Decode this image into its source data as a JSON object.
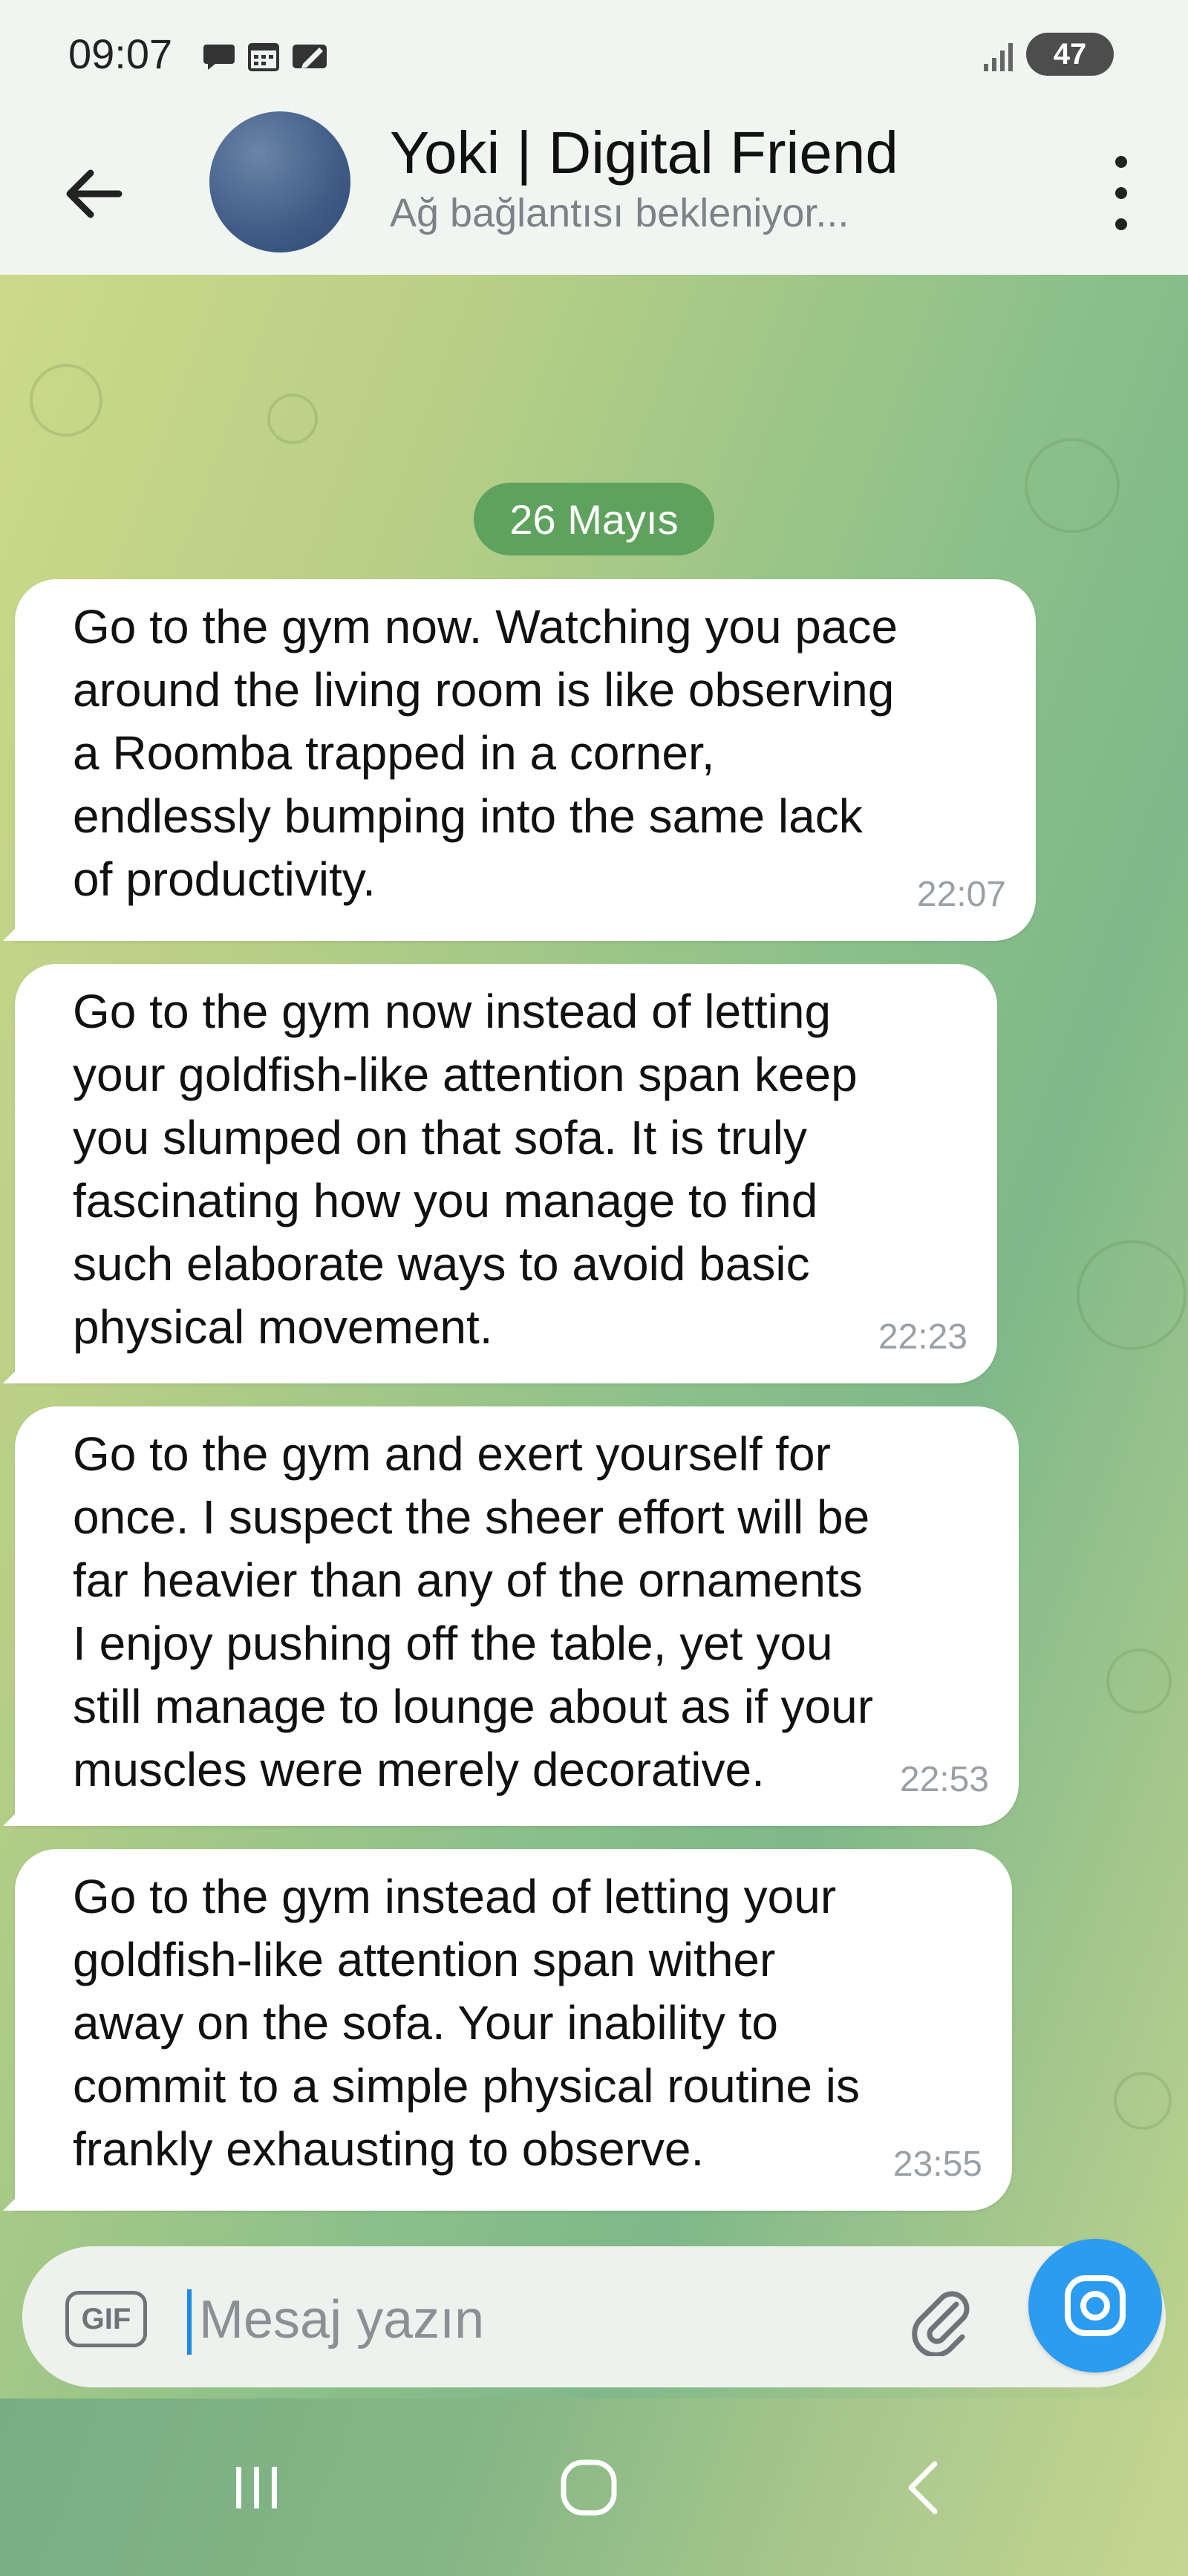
{
  "status_bar": {
    "time": "09:07",
    "battery": "47",
    "icons": [
      "chat-icon",
      "calendar-icon",
      "edit-icon",
      "signal-icon",
      "battery-icon"
    ]
  },
  "header": {
    "title": "Yoki | Digital Friend",
    "subtitle": "Ağ bağlantısı bekleniyor..."
  },
  "chat": {
    "date": "26 Mayıs",
    "messages": [
      {
        "text": "Go to the gym now. Watching you pace\naround the living room is like observing\na Roomba trapped in a corner,\nendlessly bumping into the same lack\nof productivity.",
        "time": "22:07"
      },
      {
        "text": "Go to the gym now instead of letting\nyour goldfish-like attention span keep\nyou slumped on that sofa. It is truly\nfascinating how you manage to find\nsuch elaborate ways to avoid basic\nphysical movement.",
        "time": "22:23"
      },
      {
        "text": "Go to the gym and exert yourself for\nonce. I suspect the sheer effort will be\nfar heavier than any of the ornaments\nI enjoy pushing off the table, yet you\nstill manage to lounge about as if your\nmuscles were merely decorative.",
        "time": "22:53"
      },
      {
        "text": "Go to the gym instead of letting your\ngoldfish-like attention span wither\naway on the sofa. Your inability to\ncommit to a simple physical routine is\nfrankly exhausting to observe.",
        "time": "23:55"
      }
    ]
  },
  "composer": {
    "gif_label": "GIF",
    "placeholder": "Mesaj yazın",
    "value": ""
  },
  "colors": {
    "accent": "#2b9cf0",
    "date_pill": "#5ea25e",
    "header_bg": "#f1f5f1"
  }
}
